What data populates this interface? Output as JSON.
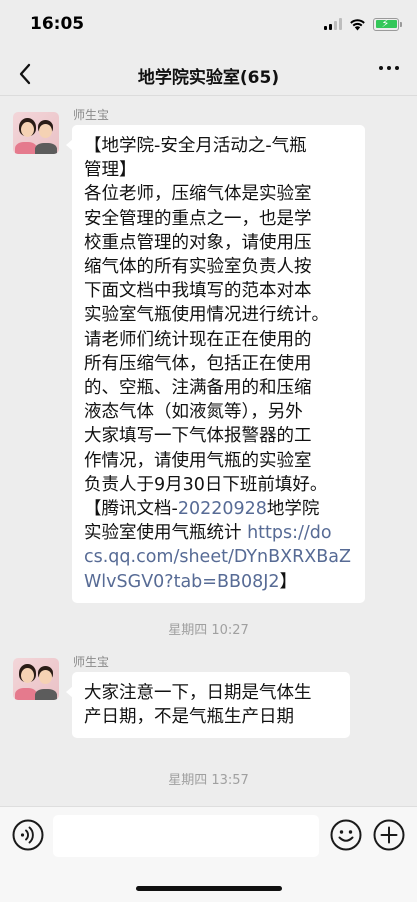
{
  "status": {
    "time": "16:05"
  },
  "nav": {
    "title": "地学院实验室(65)"
  },
  "messages": [
    {
      "sender": "师生宝",
      "lines": [
        {
          "parts": [
            {
              "text": "【地学院-安全月活动之-气瓶"
            }
          ]
        },
        {
          "parts": [
            {
              "text": "管理】"
            }
          ]
        },
        {
          "parts": [
            {
              "text": "各位老师，压缩气体是实验室"
            }
          ]
        },
        {
          "parts": [
            {
              "text": "安全管理的重点之一，也是学"
            }
          ]
        },
        {
          "parts": [
            {
              "text": "校重点管理的对象，请使用压"
            }
          ]
        },
        {
          "parts": [
            {
              "text": "缩气体的所有实验室负责人按"
            }
          ]
        },
        {
          "parts": [
            {
              "text": "下面文档中我填写的范本对本"
            }
          ]
        },
        {
          "parts": [
            {
              "text": "实验室气瓶使用情况进行统计。"
            }
          ]
        },
        {
          "parts": [
            {
              "text": "请老师们统计现在正在使用的"
            }
          ]
        },
        {
          "parts": [
            {
              "text": "所有压缩气体，包括正在使用"
            }
          ]
        },
        {
          "parts": [
            {
              "text": "的、空瓶、注满备用的和压缩"
            }
          ]
        },
        {
          "parts": [
            {
              "text": "液态气体（如液氮等），另外"
            }
          ]
        },
        {
          "parts": [
            {
              "text": "大家填写一下气体报警器的工"
            }
          ]
        },
        {
          "parts": [
            {
              "text": "作情况，请使用气瓶的实验室"
            }
          ]
        },
        {
          "parts": [
            {
              "text": "负责人于9月30日下班前填好。"
            }
          ]
        },
        {
          "parts": [
            {
              "text": "【腾讯文档-"
            },
            {
              "text": "20220928",
              "cls": "num"
            },
            {
              "text": "地学院"
            }
          ]
        },
        {
          "parts": [
            {
              "text": "实验室使用气瓶统计 "
            },
            {
              "text": "https://do",
              "cls": "link"
            }
          ]
        },
        {
          "parts": [
            {
              "text": "cs.qq.com/sheet/DYnBXRXBaZ",
              "cls": "link"
            }
          ]
        },
        {
          "parts": [
            {
              "text": "WlvSGV0?tab=BB08J2",
              "cls": "link"
            },
            {
              "text": "】"
            }
          ]
        }
      ]
    },
    {
      "sender": "师生宝",
      "lines": [
        {
          "parts": [
            {
              "text": "大家注意一下，日期是气体生"
            }
          ]
        },
        {
          "parts": [
            {
              "text": "产日期，不是气瓶生产日期"
            }
          ]
        }
      ]
    }
  ],
  "timestamps": [
    "星期四 10:27",
    "星期四 13:57"
  ],
  "input": {
    "placeholder": ""
  },
  "icons": {
    "back": "chevron-left-icon",
    "more": "more-dots-icon",
    "voice": "voice-icon",
    "emoji": "emoji-icon",
    "plus": "plus-icon"
  },
  "colors": {
    "background": "#ededed",
    "link": "#576b95",
    "bubble": "#ffffff",
    "battery": "#34c759"
  }
}
